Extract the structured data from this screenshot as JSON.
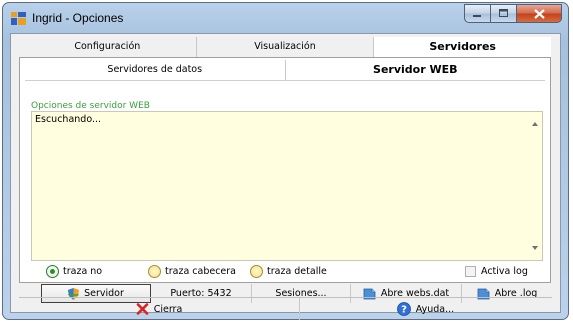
{
  "window": {
    "title": "Ingrid - Opciones"
  },
  "tabs_top": [
    "Configuración",
    "Visualización",
    "Servidores"
  ],
  "tabs_sub": [
    "Servidores de datos",
    "Servidor WEB"
  ],
  "web": {
    "group_label": "Opciones de servidor WEB",
    "log_text": "Escuchando..."
  },
  "trace": {
    "options": [
      "traza no",
      "traza cabecera",
      "traza detalle"
    ],
    "selected": "traza no",
    "active_log_label": "Activa log",
    "active_log_checked": false
  },
  "buttons": {
    "server": "Servidor",
    "port": "Puerto: 5432",
    "sessions": "Sesiones...",
    "open_webs": "Abre webs.dat",
    "open_log": "Abre .log"
  },
  "footer": {
    "close": "Cierra",
    "help": "Ayuda..."
  },
  "colors": {
    "group_label": "#3aa13a",
    "log_bg": "#fffede",
    "radio_selected": "#1c9a1c",
    "close_x": "#e02020",
    "help_icon": "#2f6fd8"
  }
}
